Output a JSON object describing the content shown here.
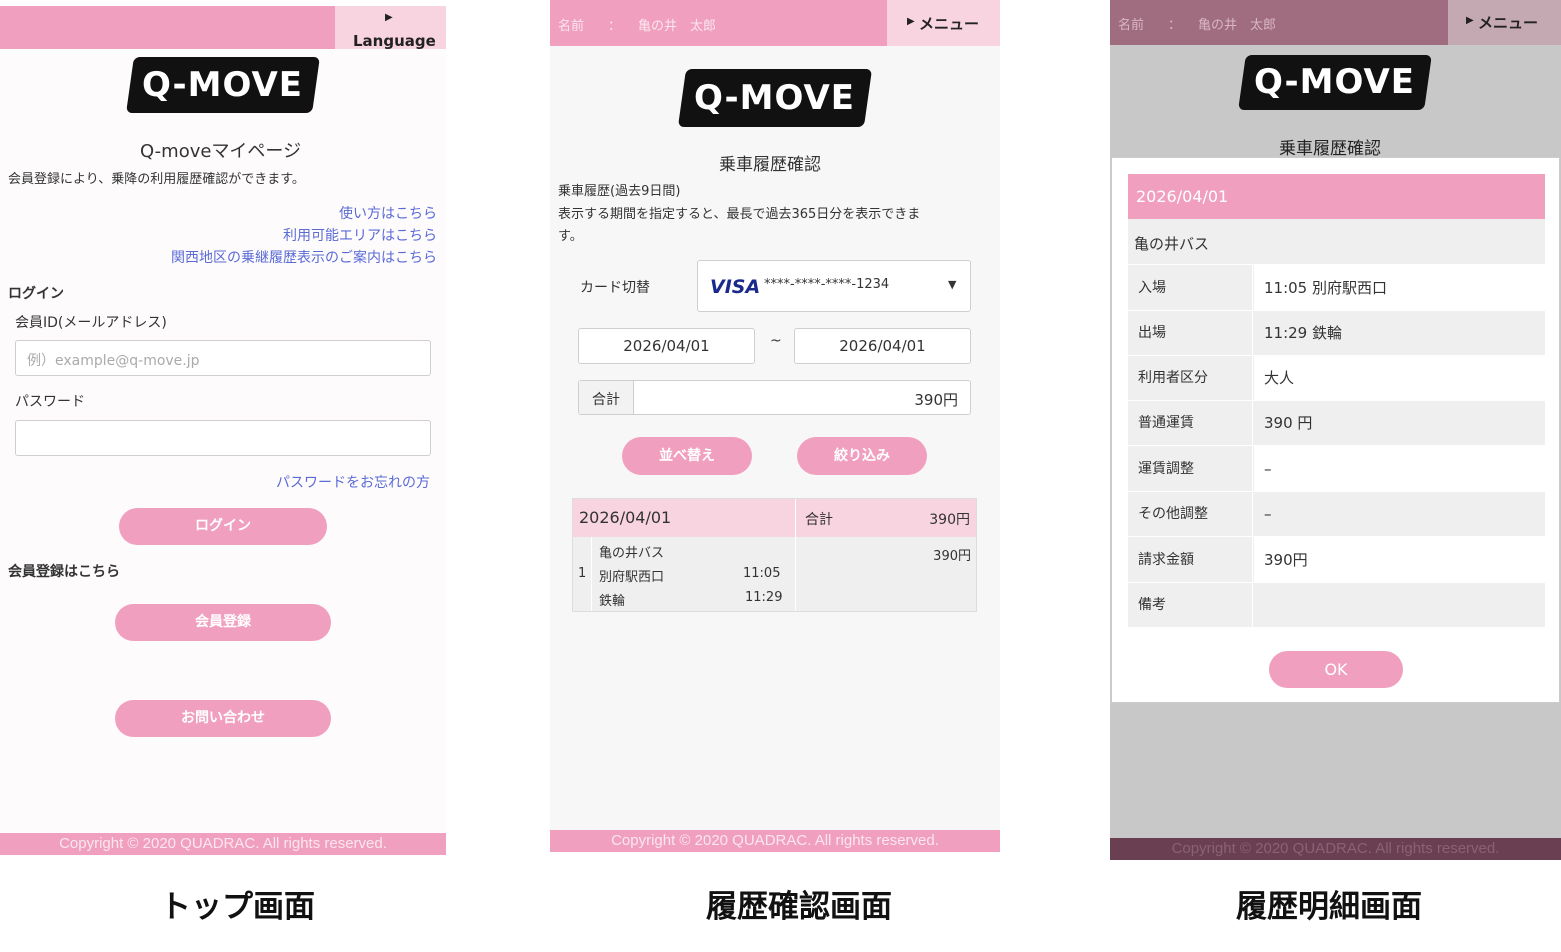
{
  "top": {
    "language_label": "Language",
    "logo": "Q-MOVE",
    "title": "Q-moveマイページ",
    "intro": "会員登録により、乗降の利用履歴確認ができます。",
    "links": [
      "使い方はこちら",
      "利用可能エリアはこちら",
      "関西地区の乗継履歴表示のご案内はこちら"
    ],
    "login_heading": "ログイン",
    "member_id_label": "会員ID(メールアドレス)",
    "member_id_placeholder": "例）example@q-move.jp",
    "password_label": "パスワード",
    "forgot_password": "パスワードをお忘れの方",
    "login_button": "ログイン",
    "register_heading": "会員登録はこちら",
    "register_button": "会員登録",
    "contact_button": "お問い合わせ",
    "footer": "Copyright © 2020 QUADRAC. All rights reserved."
  },
  "history": {
    "name_label": "名前",
    "name_sep": "：",
    "name_value": "亀の井　太郎",
    "menu_label": "メニュー",
    "logo": "Q-MOVE",
    "title": "乗車履歴確認",
    "desc1": "乗車履歴(過去9日間)",
    "desc2": "表示する期間を指定すると、最長で過去365日分を表示できま",
    "desc3": "す。",
    "card_label": "カード切替",
    "card_brand": "VISA",
    "card_number": "****-****-****-1234",
    "date_from": "2026/04/01",
    "date_tilde": "~",
    "date_to": "2026/04/01",
    "total_label": "合計",
    "total_value": "390円",
    "sort_button": "並べ替え",
    "filter_button": "絞り込み",
    "table": {
      "date": "2026/04/01",
      "total_label": "合計",
      "total_value": "390円",
      "row_no": "1",
      "operator": "亀の井バス",
      "from_stop": "別府駅西口",
      "from_time": "11:05",
      "to_stop": "鉄輪",
      "to_time": "11:29",
      "fare": "390円"
    },
    "footer": "Copyright © 2020 QUADRAC. All rights reserved."
  },
  "detail": {
    "name_label": "名前",
    "name_sep": "：",
    "name_value": "亀の井　太郎",
    "menu_label": "メニュー",
    "logo": "Q-MOVE",
    "title": "乗車履歴確認",
    "date": "2026/04/01",
    "operator": "亀の井バス",
    "rows": [
      {
        "label": "入場",
        "value": "11:05 別府駅西口"
      },
      {
        "label": "出場",
        "value": "11:29 鉄輪"
      },
      {
        "label": "利用者区分",
        "value": "大人"
      },
      {
        "label": "普通運賃",
        "value": "390 円"
      },
      {
        "label": "運賃調整",
        "value": "–"
      },
      {
        "label": "その他調整",
        "value": "–"
      },
      {
        "label": "請求金額",
        "value": "390円"
      },
      {
        "label": "備考",
        "value": ""
      }
    ],
    "ok_button": "OK",
    "footer": "Copyright © 2020 QUADRAC. All rights reserved."
  },
  "captions": [
    "トップ画面",
    "履歴確認画面",
    "履歴明細画面"
  ],
  "colors": {
    "pink": "#f0a0be",
    "pink_light": "#f8d3e0",
    "link": "#5b6bd6"
  }
}
